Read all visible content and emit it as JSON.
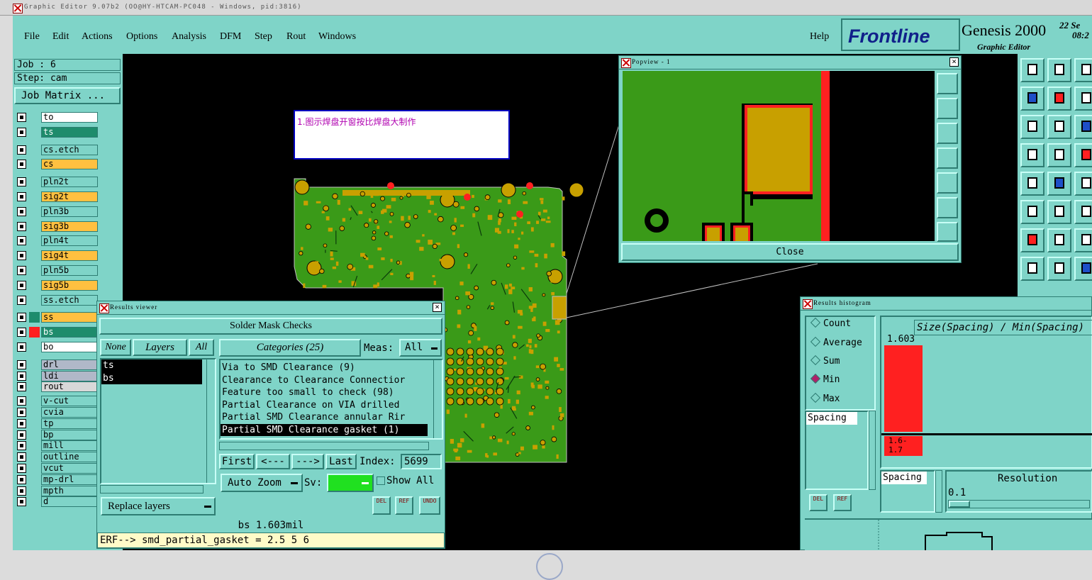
{
  "window": {
    "title": "Graphic Editor 9.07b2 (OO@HY-HTCAM-PC048 - Windows, pid:3816)"
  },
  "menu": {
    "items": [
      "File",
      "Edit",
      "Actions",
      "Options",
      "Analysis",
      "DFM",
      "Step",
      "Rout",
      "Windows"
    ],
    "help": "Help"
  },
  "brand": {
    "logo": "Frontline",
    "product": "Genesis 2000",
    "subtitle": "Graphic Editor",
    "date": "22 Se",
    "time": "08:2"
  },
  "job": {
    "job_label": "Job : 6",
    "step_label": "Step: cam",
    "matrix_button": "Job Matrix ..."
  },
  "layers": [
    {
      "name": "to",
      "color": "#ffffff"
    },
    {
      "name": "ts",
      "color": "#1e8c6c"
    },
    {
      "name": "cs.etch",
      "color": "#7fd4c8"
    },
    {
      "name": "cs",
      "color": "#ffc040"
    },
    {
      "name": "pln2t",
      "color": "#7fd4c8"
    },
    {
      "name": "sig2t",
      "color": "#ffc040"
    },
    {
      "name": "pln3b",
      "color": "#7fd4c8"
    },
    {
      "name": "sig3b",
      "color": "#ffc040"
    },
    {
      "name": "pln4t",
      "color": "#7fd4c8"
    },
    {
      "name": "sig4t",
      "color": "#ffc040"
    },
    {
      "name": "pln5b",
      "color": "#7fd4c8"
    },
    {
      "name": "sig5b",
      "color": "#ffc040"
    },
    {
      "name": "ss.etch",
      "color": "#7fd4c8"
    },
    {
      "name": "ss",
      "color": "#ffc040"
    },
    {
      "name": "bs",
      "color": "#1e8c6c"
    },
    {
      "name": "bo",
      "color": "#ffffff"
    },
    {
      "name": "drl",
      "color": "#b0b8c8"
    },
    {
      "name": "ldi",
      "color": "#b0b8c8"
    },
    {
      "name": "rout",
      "color": "#d8d8d8"
    },
    {
      "name": "v-cut",
      "color": "#7fd4c8"
    },
    {
      "name": "cvia",
      "color": "#7fd4c8"
    },
    {
      "name": "tp",
      "color": "#7fd4c8"
    },
    {
      "name": "bp",
      "color": "#7fd4c8"
    },
    {
      "name": "mill",
      "color": "#7fd4c8"
    },
    {
      "name": "outline",
      "color": "#7fd4c8"
    },
    {
      "name": "vcut",
      "color": "#7fd4c8"
    },
    {
      "name": "mp-drl",
      "color": "#7fd4c8"
    },
    {
      "name": "mpth",
      "color": "#7fd4c8"
    },
    {
      "name": "d",
      "color": "#7fd4c8"
    }
  ],
  "annotation": {
    "text": "1.图示焊盘开窗按比焊盘大制作"
  },
  "popview": {
    "title": "Popview - 1",
    "close": "Close"
  },
  "results_viewer": {
    "title": "Results viewer",
    "heading": "Solder Mask Checks",
    "none": "None",
    "layers": "Layers",
    "all": "All",
    "layer_list": [
      "ts",
      "bs"
    ],
    "categories": "Categories (25)",
    "meas_label": "Meas:",
    "meas_value": "All",
    "category_list": [
      "Via to SMD Clearance (9)",
      "Clearance to Clearance Connectior",
      "Feature too small to check (98)",
      "Partial Clearance on VIA drilled",
      "Partial SMD Clearance annular Rir",
      "Partial SMD Clearance gasket (1)"
    ],
    "first": "First",
    "prev": "<---",
    "next": "--->",
    "last": "Last",
    "index_label": "Index:",
    "index_value": "5699",
    "auto_zoom": "Auto Zoom",
    "sv_label": "Sv:",
    "show_all": "Show All",
    "replace_layers": "Replace layers",
    "del": "DEL",
    "ref": "REF",
    "undo": "UNDO",
    "status": "bs 1.603mil",
    "erf": "ERF--> smd_partial_gasket = 2.5 5 6"
  },
  "histogram": {
    "title": "Results histogram",
    "options": [
      "Count",
      "Average",
      "Sum",
      "Min",
      "Max"
    ],
    "selected": "Min",
    "chart_title": "Size(Spacing) / Min(Spacing)",
    "bar_value": "1.603",
    "bin_label": "1.6-\n1.7",
    "list_item": "Spacing",
    "spacing_label": "Spacing",
    "resolution_label": "Resolution",
    "resolution_value": "0.1",
    "del": "DEL",
    "ref": "REF"
  },
  "colors": {
    "panel": "#7fd4c8",
    "pcb_green": "#3a9a18",
    "pad_gold": "#c8a000",
    "red": "#ff2020"
  }
}
